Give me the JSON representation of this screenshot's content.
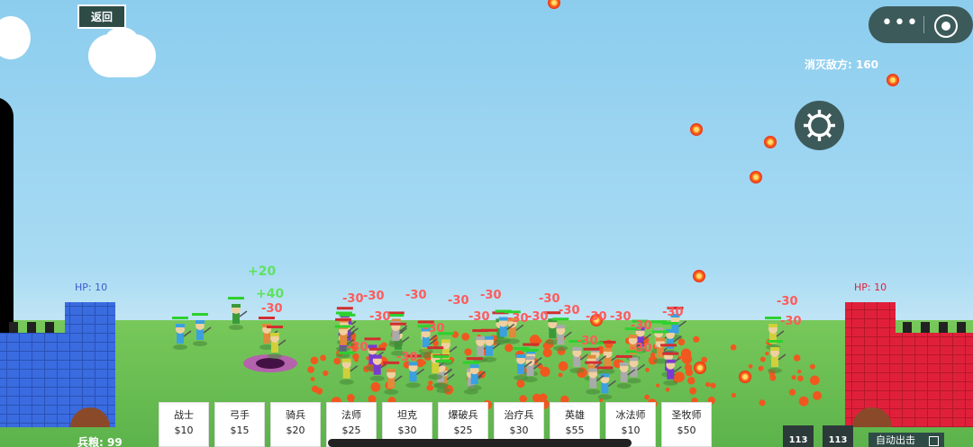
{
  "header": {
    "back_label": "返回",
    "kills_label": "消灭敌方: 160"
  },
  "icons": {
    "more": "more-dots-icon",
    "close": "target-circle-icon",
    "settings": "gear-icon"
  },
  "castles": {
    "player": {
      "hp_label": "HP: 10",
      "color": "#3a6be0"
    },
    "enemy": {
      "hp_label": "HP: 10",
      "color": "#e0203a"
    }
  },
  "floating_text": {
    "heals": [
      "+20",
      "+40"
    ],
    "damage": [
      "-30"
    ]
  },
  "units": [
    {
      "name": "战士",
      "price": "$10"
    },
    {
      "name": "弓手",
      "price": "$15"
    },
    {
      "name": "骑兵",
      "price": "$20"
    },
    {
      "name": "法师",
      "price": "$25"
    },
    {
      "name": "坦克",
      "price": "$30"
    },
    {
      "name": "爆破兵",
      "price": "$25"
    },
    {
      "name": "治疗兵",
      "price": "$30"
    },
    {
      "name": "英雄",
      "price": "$55"
    },
    {
      "name": "冰法师",
      "price": "$10"
    },
    {
      "name": "圣牧师",
      "price": "$50"
    }
  ],
  "footer": {
    "food_label": "兵粮: 99",
    "skill_1": "113",
    "skill_2": "113",
    "auto_label": "自动出击"
  }
}
